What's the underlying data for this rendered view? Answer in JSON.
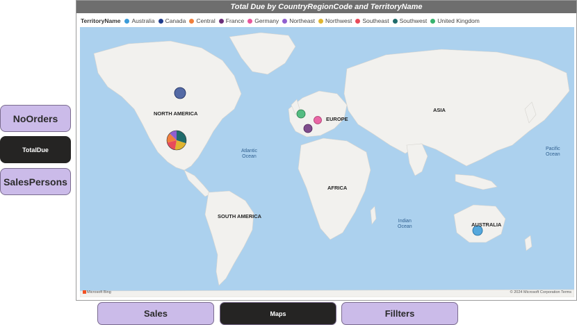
{
  "nav": {
    "side": [
      {
        "label": "NoOrders",
        "style": "light"
      },
      {
        "label": "TotalDue",
        "style": "dark"
      },
      {
        "label": "SalesPersons",
        "style": "light"
      }
    ],
    "bottom": [
      {
        "label": "Sales",
        "style": "light"
      },
      {
        "label": "Maps",
        "style": "dark"
      },
      {
        "label": "Fillters",
        "style": "light"
      }
    ]
  },
  "visual": {
    "title": "Total Due by CountryRegionCode and TerritoryName",
    "legend_title": "TerritoryName",
    "legend": [
      {
        "name": "Australia",
        "color": "#3a9bd9"
      },
      {
        "name": "Canada",
        "color": "#1f3c8c"
      },
      {
        "name": "Central",
        "color": "#f07f3c"
      },
      {
        "name": "France",
        "color": "#6b2f7a"
      },
      {
        "name": "Germany",
        "color": "#e8569c"
      },
      {
        "name": "Northeast",
        "color": "#8f5fcf"
      },
      {
        "name": "Northwest",
        "color": "#e0b530"
      },
      {
        "name": "Southeast",
        "color": "#e84b5a"
      },
      {
        "name": "Southwest",
        "color": "#1f6b6b"
      },
      {
        "name": "United Kingdom",
        "color": "#38b36f"
      }
    ],
    "map": {
      "continent_labels": {
        "north_america": "NORTH AMERICA",
        "europe": "EUROPE",
        "asia": "ASIA",
        "africa": "AFRICA",
        "south_america": "SOUTH AMERICA",
        "australia": "AUSTRALIA"
      },
      "ocean_labels": {
        "atlantic_1": "Atlantic",
        "atlantic_2": "Ocean",
        "pacific_1": "Pacific",
        "pacific_2": "Ocean",
        "indian_1": "Indian",
        "indian_2": "Ocean"
      },
      "attribution_left": "Microsoft Bing",
      "attribution_right": "© 2024 Microsoft Corporation  Terms"
    }
  }
}
